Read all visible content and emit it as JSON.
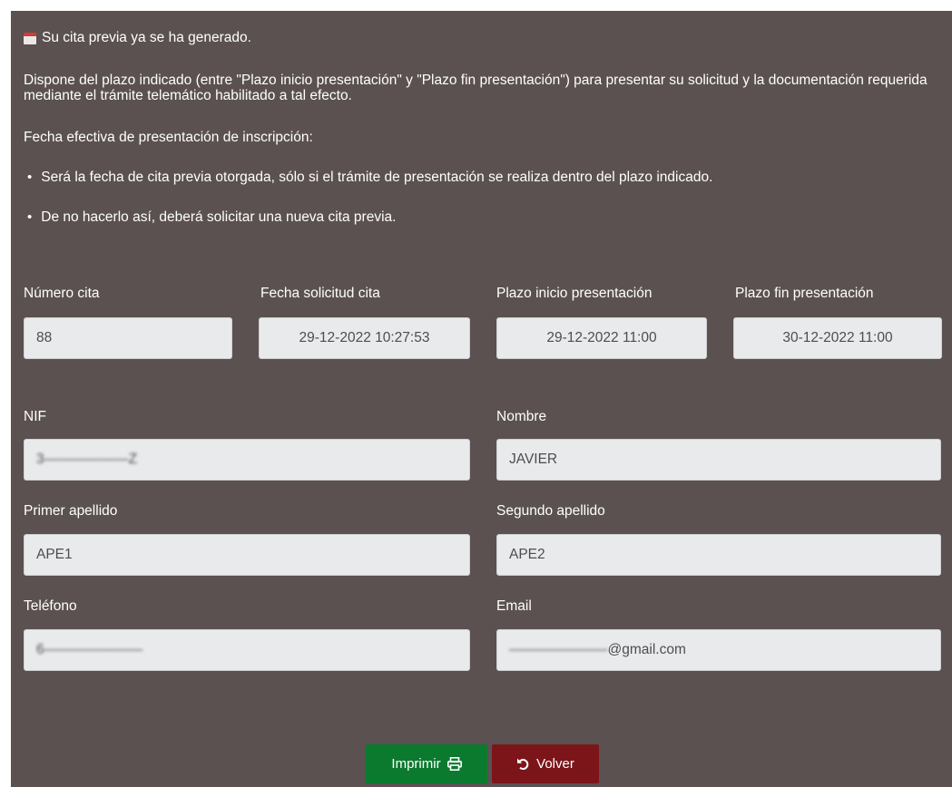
{
  "notice": {
    "icon": "calendar-icon",
    "text": "Su cita previa ya se ha generado."
  },
  "instructions": {
    "paragraph": "Dispone del plazo indicado (entre \"Plazo inicio presentación\" y \"Plazo fin presentación\") para presentar su solicitud y la documentación requerida mediante el trámite telemático habilitado a tal efecto.",
    "heading": "Fecha efectiva de presentación de inscripción:",
    "bullets": [
      "Será la fecha de cita previa otorgada, sólo si el trámite de presentación se realiza dentro del plazo indicado.",
      "De no hacerlo así, deberá solicitar una nueva cita previa."
    ]
  },
  "appointment": {
    "numero_label": "Número cita",
    "numero_value": "88",
    "fecha_label": "Fecha solicitud cita",
    "fecha_value": "29-12-2022 10:27:53",
    "inicio_label": "Plazo inicio presentación",
    "inicio_value": "29-12-2022 11:00",
    "fin_label": "Plazo fin presentación",
    "fin_value": "30-12-2022 11:00"
  },
  "person": {
    "nif_label": "NIF",
    "nif_value": "3——————Z",
    "nombre_label": "Nombre",
    "nombre_value": "JAVIER",
    "apellido1_label": "Primer apellido",
    "apellido1_value": "APE1",
    "apellido2_label": "Segundo apellido",
    "apellido2_value": "APE2",
    "telefono_label": "Teléfono",
    "telefono_value": "6———————",
    "email_label": "Email",
    "email_value_redacted": "———————",
    "email_value_domain": "@gmail.com"
  },
  "buttons": {
    "print_label": "Imprimir",
    "print_icon": "printer-icon",
    "back_label": "Volver",
    "back_icon": "undo-icon"
  },
  "colors": {
    "panel_bg": "#5a5150",
    "print_btn": "#0b7a2f",
    "back_btn": "#7c1519",
    "field_bg": "#e9eaeb"
  }
}
